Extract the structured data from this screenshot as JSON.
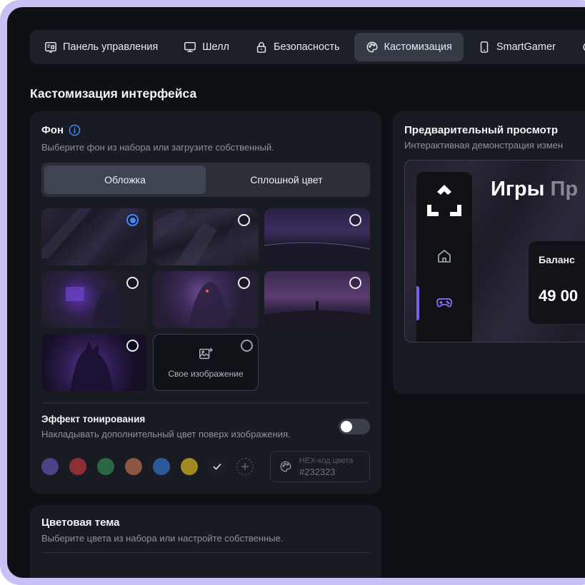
{
  "nav": {
    "tabs": [
      {
        "label": "Панель управления",
        "icon": "dashboard-icon",
        "active": false
      },
      {
        "label": "Шелл",
        "icon": "monitor-icon",
        "active": false
      },
      {
        "label": "Безопасность",
        "icon": "lock-icon",
        "active": false
      },
      {
        "label": "Кастомизация",
        "icon": "palette-icon",
        "active": true
      },
      {
        "label": "SmartGamer",
        "icon": "phone-icon",
        "active": false
      }
    ]
  },
  "page": {
    "title": "Кастомизация интерфейса"
  },
  "background": {
    "title": "Фон",
    "subtitle": "Выберите фон из набора или загрузите собственный.",
    "segments": [
      {
        "label": "Обложка",
        "active": true
      },
      {
        "label": "Сплошной цвет",
        "active": false
      }
    ],
    "selected_index": 0,
    "custom_label": "Свое изображение",
    "tint": {
      "title": "Эффект тонирования",
      "subtitle": "Накладывать дополнительный цвет поверх изображения.",
      "enabled": false
    },
    "swatches": [
      "#4d4389",
      "#8e2f35",
      "#2b6645",
      "#8c5640",
      "#2c5a99",
      "#a18a22"
    ],
    "hex": {
      "placeholder": "HEX-код цвета",
      "value": "#232323"
    }
  },
  "color_theme": {
    "title": "Цветовая тема",
    "subtitle": "Выберите цвета из набора или настройте собственные."
  },
  "preview": {
    "title": "Предварительный просмотр",
    "subtitle": "Интерактивная демонстрация измен",
    "heading": "Игры",
    "heading_muted": "Пр",
    "balance_label": "Баланс",
    "balance_value": "49 00"
  },
  "colors": {
    "accent": "#3d8bff",
    "active_bar": "#7b5cff",
    "frame": "#c9c1f3"
  }
}
